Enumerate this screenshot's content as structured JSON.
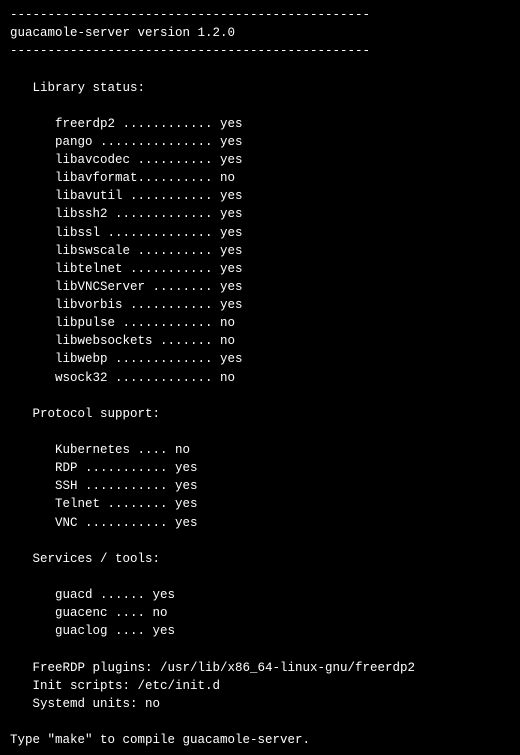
{
  "divider": "------------------------------------------------",
  "title": "guacamole-server version 1.2.0",
  "sections": {
    "library": {
      "heading": "Library status:",
      "items": [
        {
          "name": "freerdp2",
          "dots": " ............ ",
          "status": "yes"
        },
        {
          "name": "pango",
          "dots": " ............... ",
          "status": "yes"
        },
        {
          "name": "libavcodec",
          "dots": " .......... ",
          "status": "yes"
        },
        {
          "name": "libavformat",
          "dots": ".......... ",
          "status": "no"
        },
        {
          "name": "libavutil",
          "dots": " ........... ",
          "status": "yes"
        },
        {
          "name": "libssh2",
          "dots": " ............. ",
          "status": "yes"
        },
        {
          "name": "libssl",
          "dots": " .............. ",
          "status": "yes"
        },
        {
          "name": "libswscale",
          "dots": " .......... ",
          "status": "yes"
        },
        {
          "name": "libtelnet",
          "dots": " ........... ",
          "status": "yes"
        },
        {
          "name": "libVNCServer",
          "dots": " ........ ",
          "status": "yes"
        },
        {
          "name": "libvorbis",
          "dots": " ........... ",
          "status": "yes"
        },
        {
          "name": "libpulse",
          "dots": " ............ ",
          "status": "no"
        },
        {
          "name": "libwebsockets",
          "dots": " ....... ",
          "status": "no"
        },
        {
          "name": "libwebp",
          "dots": " ............. ",
          "status": "yes"
        },
        {
          "name": "wsock32",
          "dots": " ............. ",
          "status": "no"
        }
      ]
    },
    "protocol": {
      "heading": "Protocol support:",
      "items": [
        {
          "name": "Kubernetes",
          "dots": " .... ",
          "status": "no"
        },
        {
          "name": "RDP",
          "dots": " ........... ",
          "status": "yes"
        },
        {
          "name": "SSH",
          "dots": " ........... ",
          "status": "yes"
        },
        {
          "name": "Telnet",
          "dots": " ........ ",
          "status": "yes"
        },
        {
          "name": "VNC",
          "dots": " ........... ",
          "status": "yes"
        }
      ]
    },
    "services": {
      "heading": "Services / tools:",
      "items": [
        {
          "name": "guacd",
          "dots": " ...... ",
          "status": "yes"
        },
        {
          "name": "guacenc",
          "dots": " .... ",
          "status": "no"
        },
        {
          "name": "guaclog",
          "dots": " .... ",
          "status": "yes"
        }
      ]
    }
  },
  "footer": {
    "plugins": "FreeRDP plugins: /usr/lib/x86_64-linux-gnu/freerdp2",
    "init": "Init scripts: /etc/init.d",
    "systemd": "Systemd units: no"
  },
  "final": "Type \"make\" to compile guacamole-server."
}
